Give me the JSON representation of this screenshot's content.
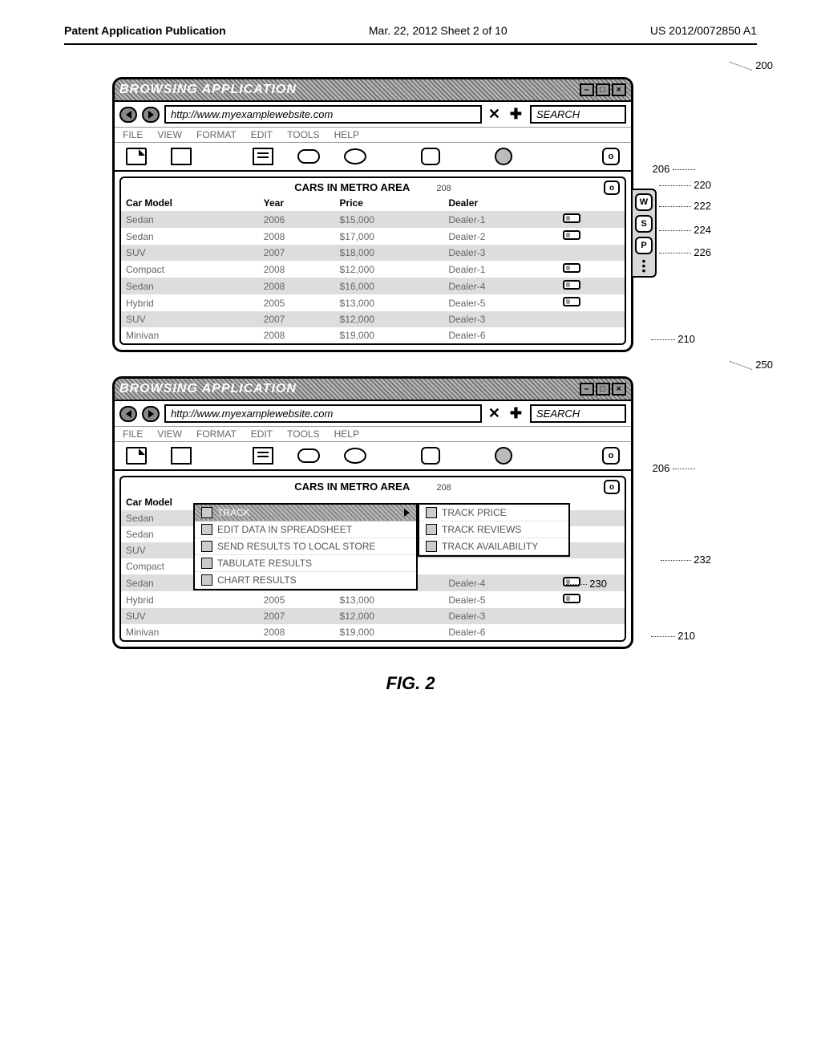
{
  "header": {
    "left": "Patent Application Publication",
    "center": "Mar. 22, 2012  Sheet 2 of 10",
    "right": "US 2012/0072850 A1"
  },
  "figure_label": "FIG. 2",
  "window": {
    "title": "BROWSING APPLICATION",
    "url": "http://www.myexamplewebsite.com",
    "search_placeholder": "SEARCH",
    "menus": [
      "FILE",
      "VIEW",
      "FORMAT",
      "EDIT",
      "TOOLS",
      "HELP"
    ],
    "content_title": "CARS IN METRO AREA",
    "widget_label": "o",
    "toolbar_circle_label": "o",
    "table": {
      "headers": [
        "Car Model",
        "Year",
        "Price",
        "Dealer"
      ],
      "rows": [
        {
          "model": "Sedan",
          "year": "2006",
          "price": "$15,000",
          "dealer": "Dealer-1",
          "scroll": true,
          "shade": true
        },
        {
          "model": "Sedan",
          "year": "2008",
          "price": "$17,000",
          "dealer": "Dealer-2",
          "scroll": true,
          "shade": false
        },
        {
          "model": "SUV",
          "year": "2007",
          "price": "$18,000",
          "dealer": "Dealer-3",
          "scroll": false,
          "shade": true
        },
        {
          "model": "Compact",
          "year": "2008",
          "price": "$12,000",
          "dealer": "Dealer-1",
          "scroll": true,
          "shade": false
        },
        {
          "model": "Sedan",
          "year": "2008",
          "price": "$16,000",
          "dealer": "Dealer-4",
          "scroll": true,
          "shade": true
        },
        {
          "model": "Hybrid",
          "year": "2005",
          "price": "$13,000",
          "dealer": "Dealer-5",
          "scroll": true,
          "shade": false
        },
        {
          "model": "SUV",
          "year": "2007",
          "price": "$12,000",
          "dealer": "Dealer-3",
          "scroll": false,
          "shade": true
        },
        {
          "model": "Minivan",
          "year": "2008",
          "price": "$19,000",
          "dealer": "Dealer-6",
          "scroll": false,
          "shade": false
        }
      ]
    }
  },
  "callouts_top": {
    "ref200": "200",
    "ref220": "220",
    "ref222": "222",
    "ref224": "224",
    "ref226": "226",
    "ref210": "210",
    "ref208": "208",
    "ref206": "206"
  },
  "side_buttons": {
    "w": "W",
    "s": "S",
    "p": "P"
  },
  "menu1": {
    "items": [
      {
        "label": "TRACK",
        "highlight": true,
        "chev": true
      },
      {
        "label": "EDIT DATA IN SPREADSHEET"
      },
      {
        "label": "SEND RESULTS TO LOCAL STORE"
      },
      {
        "label": "TABULATE RESULTS"
      },
      {
        "label": "CHART RESULTS"
      }
    ]
  },
  "menu2": {
    "items": [
      {
        "label": "TRACK PRICE"
      },
      {
        "label": "TRACK REVIEWS"
      },
      {
        "label": "TRACK AVAILABILITY"
      }
    ]
  },
  "callouts_bottom": {
    "ref250": "250",
    "ref230": "230",
    "ref232": "232",
    "ref210b": "210",
    "ref208b": "208",
    "ref206b": "206"
  }
}
